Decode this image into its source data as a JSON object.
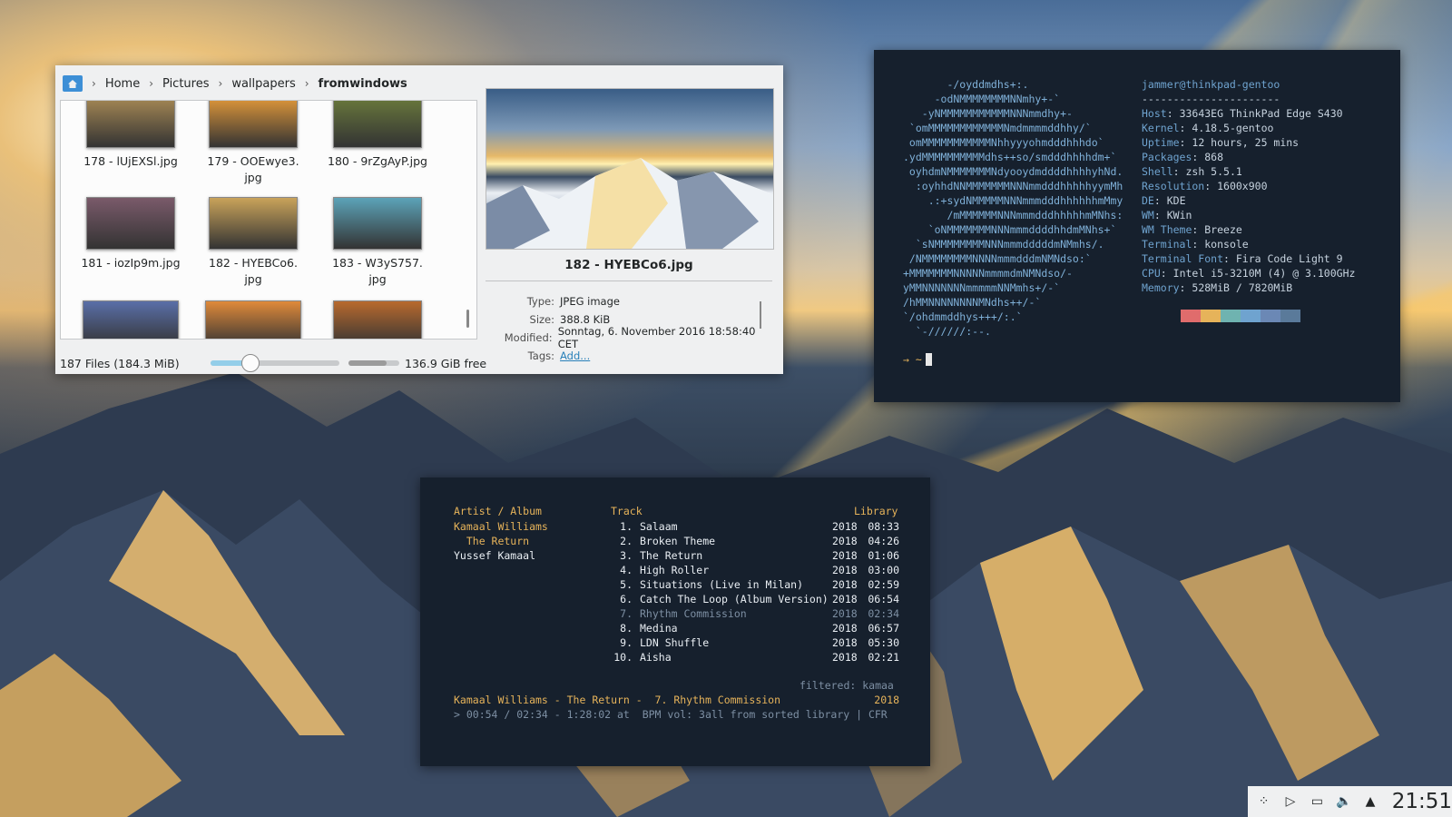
{
  "dolphin": {
    "breadcrumb": [
      "Home",
      "Pictures",
      "wallpapers",
      "fromwindows"
    ],
    "files": [
      {
        "name": "178 - lUjEXSl.jpg",
        "thumb": "#a88a55"
      },
      {
        "name": "179 - OOEwye3.\njpg",
        "thumb": "#e49a3a"
      },
      {
        "name": "180 - 9rZgAyP.jpg",
        "thumb": "#6b7a3c"
      },
      {
        "name": "181 - iozIp9m.jpg",
        "thumb": "#7a5a6a"
      },
      {
        "name": "182 - HYEBCo6.\njpg",
        "thumb": "#c9a35a"
      },
      {
        "name": "183 - W3yS757.\njpg",
        "thumb": "#5ca3b8"
      },
      {
        "name": "",
        "thumb": "#5a6fa8"
      },
      {
        "name": "",
        "thumb": "#e08a3a"
      },
      {
        "name": "",
        "thumb": "#b86a2e"
      }
    ],
    "preview_title": "182 - HYEBCo6.jpg",
    "meta": [
      {
        "k": "Type:",
        "v": "JPEG image"
      },
      {
        "k": "Size:",
        "v": "388.8 KiB"
      },
      {
        "k": "Modified:",
        "v": "Sonntag, 6. November 2016 18:58:40 CET"
      },
      {
        "k": "Tags:",
        "v": "Add...",
        "link": true
      }
    ],
    "status_count": "187 Files (184.3 MiB)",
    "zoom_level": 0.3,
    "space_used": 0.75,
    "free_space": "136.9 GiB free"
  },
  "neofetch": {
    "ascii": "       -/oyddmdhs+:.\n     -odNMMMMMMMMNNmhy+-`\n   -yNMMMMMMMMMMMNNNmmdhy+-\n `omMMMMMMMMMMMMNmdmmmmddhhy/`\n omMMMMMMMMMMMNhhyyyohmdddhhhdo`\n.ydMMMMMMMMMMdhs++so/smdddhhhhdm+`\n oyhdmNMMMMMMMNdyooydmddddhhhhyhNd.\n  :oyhhdNNMMMMMMMNNNmmdddhhhhhyymMh\n    .:+sydNMMMMMNNNmmmdddhhhhhhmMmy\n       /mMMMMMMNNNmmmdddhhhhhmMNhs:\n    `oNMMMMMMMNNNmmmddddhhdmMNhs+`\n  `sNMMMMMMMMNNNmmmdddddmNMmhs/.\n /NMMMMMMMMNNNNmmmdddmNMNdso:`\n+MMMMMMMNNNNNmmmmdmNMNdso/-\nyMMNNNNNNNmmmmmNNMmhs+/-`\n/hMMNNNNNNNNMNdhs++/-`\n`/ohdmmddhys+++/:.`\n  `-//////:--.",
    "user_host": "jammer@thinkpad-gentoo",
    "divider": "----------------------",
    "fields": [
      {
        "k": "Host",
        "v": "33643EG ThinkPad Edge S430"
      },
      {
        "k": "Kernel",
        "v": "4.18.5-gentoo"
      },
      {
        "k": "Uptime",
        "v": "12 hours, 25 mins"
      },
      {
        "k": "Packages",
        "v": "868"
      },
      {
        "k": "Shell",
        "v": "zsh 5.5.1"
      },
      {
        "k": "Resolution",
        "v": "1600x900"
      },
      {
        "k": "DE",
        "v": "KDE"
      },
      {
        "k": "WM",
        "v": "KWin"
      },
      {
        "k": "WM Theme",
        "v": "Breeze"
      },
      {
        "k": "Terminal",
        "v": "konsole"
      },
      {
        "k": "Terminal Font",
        "v": "Fira Code Light 9"
      },
      {
        "k": "CPU",
        "v": "Intel i5-3210M (4) @ 3.100GHz"
      },
      {
        "k": "Memory",
        "v": "528MiB / 7820MiB"
      }
    ],
    "swatches": [
      "#16202d",
      "#e06c6c",
      "#e6b35a",
      "#6fb3b0",
      "#6fa3cf",
      "#6b88b5",
      "#5a7a9a",
      "#16202d"
    ],
    "prompt": "→ ~"
  },
  "cmus": {
    "col_artist": "Artist / Album",
    "col_track": "Track",
    "col_library": "Library",
    "library": [
      {
        "label": "Kamaal Williams",
        "color": "#e6b35a"
      },
      {
        "label": "  The Return",
        "color": "#e6b35a"
      },
      {
        "label": "Yussef Kamaal",
        "color": "#e9eef3"
      }
    ],
    "tracks": [
      {
        "n": "1.",
        "title": "Salaam",
        "year": "2018",
        "dur": "08:33"
      },
      {
        "n": "2.",
        "title": "Broken Theme",
        "year": "2018",
        "dur": "04:26"
      },
      {
        "n": "3.",
        "title": "The Return",
        "year": "2018",
        "dur": "01:06"
      },
      {
        "n": "4.",
        "title": "High Roller",
        "year": "2018",
        "dur": "03:00"
      },
      {
        "n": "5.",
        "title": "Situations (Live in Milan)",
        "year": "2018",
        "dur": "02:59"
      },
      {
        "n": "6.",
        "title": "Catch The Loop (Album Version)",
        "year": "2018",
        "dur": "06:54"
      },
      {
        "n": "7.",
        "title": "Rhythm Commission",
        "year": "2018",
        "dur": "02:34",
        "dim": true
      },
      {
        "n": "8.",
        "title": "Medina",
        "year": "2018",
        "dur": "06:57"
      },
      {
        "n": "9.",
        "title": "LDN Shuffle",
        "year": "2018",
        "dur": "05:30"
      },
      {
        "n": "10.",
        "title": "Aisha",
        "year": "2018",
        "dur": "02:21"
      }
    ],
    "filtered": "filtered: kamaa",
    "now_playing": "Kamaal Williams - The Return -  7. Rhythm Commission",
    "now_playing_year": "2018",
    "position": "> 00:54 / 02:34 - 1:28:02 at  BPM vol: 3all from sorted library | CFR"
  },
  "tray": {
    "clock": "21:51"
  }
}
